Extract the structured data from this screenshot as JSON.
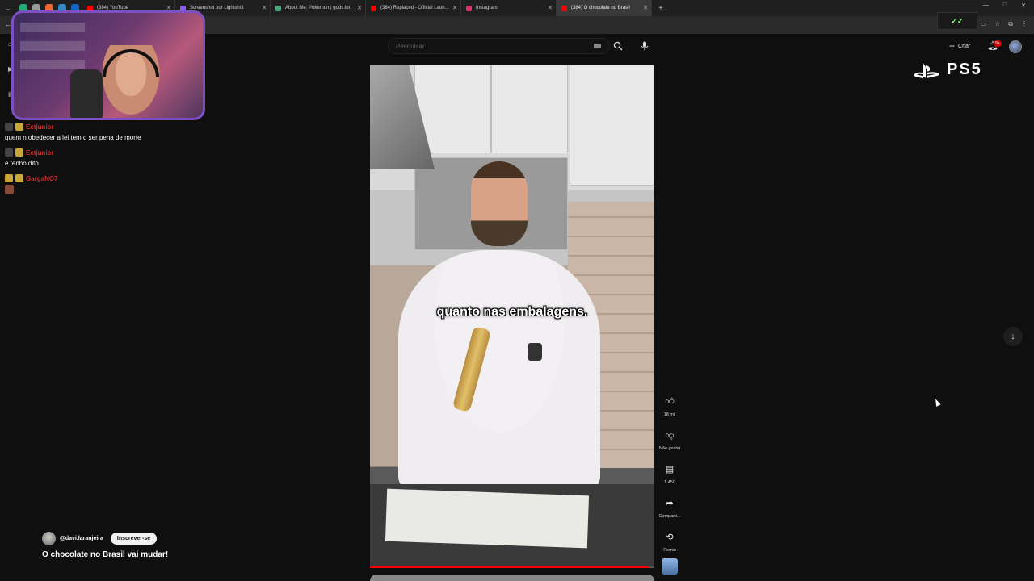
{
  "browser": {
    "tabs": [
      {
        "label": "(384) YouTube",
        "color": "#ff0000"
      },
      {
        "label": "Screenshot por Lightshot",
        "color": "#8a5cf6"
      },
      {
        "label": "About Me: Pokemon | gods.lun",
        "color": "#4a7"
      },
      {
        "label": "(384) Replaced - Official Laun...",
        "color": "#ff0000"
      },
      {
        "label": "Instagram",
        "color": "#e1306c"
      },
      {
        "label": "(384) O chocolate no Brasil",
        "color": "#ff0000",
        "active": true
      }
    ],
    "new_tab": "+"
  },
  "youtube": {
    "search_placeholder": "Pesquisar",
    "create_label": "Criar",
    "notif_badge": "9+"
  },
  "overlay": {
    "ps5_text": "PS5"
  },
  "chat": {
    "messages": [
      {
        "user": "Ectjunior",
        "text": "quem n obedecer a lei tem q ser pena de morte"
      },
      {
        "user": "Ectjunior",
        "text": "e tenho dito"
      },
      {
        "user": "GargaNO7",
        "text": ""
      }
    ]
  },
  "short": {
    "caption": "quanto nas embalagens.",
    "likes": "18 mil",
    "dislike_label": "Não gostei",
    "comments": "1.450",
    "share_label": "Comparti...",
    "remix_label": "Remix",
    "progress": 0.98
  },
  "channel": {
    "handle": "@davi.laranjeira",
    "subscribe_label": "Inscrever-se",
    "video_title": "O chocolate no Brasil vai mudar!"
  },
  "colors": {
    "background": "#0f0f0f",
    "accent": "#ff0000",
    "chat_user": "#d02b2b",
    "webcam_border": "#7d4fc2"
  },
  "icons": {
    "like": "thumb-up-icon",
    "dislike": "thumb-down-icon",
    "comment": "comment-icon",
    "share": "share-icon",
    "remix": "remix-icon",
    "search": "search-icon",
    "mic": "mic-icon",
    "bell": "bell-icon",
    "scroll": "arrow-down-icon"
  }
}
